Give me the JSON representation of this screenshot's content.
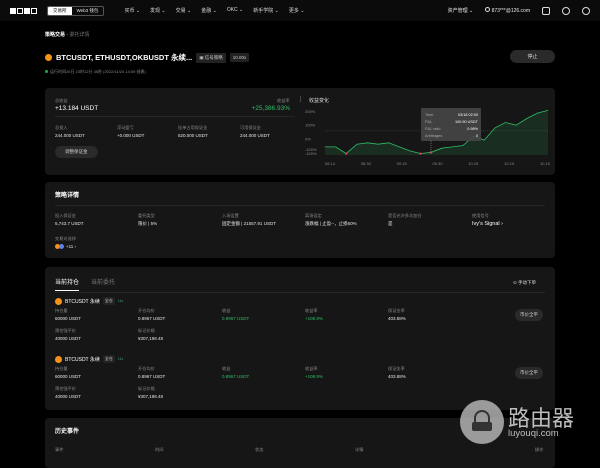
{
  "nav": {
    "exchange_tab": "交易所",
    "web3_tab": "Web3 钱包",
    "menu": [
      "买币 ⌄",
      "发现 ⌄",
      "交易 ⌄",
      "金融 ⌄",
      "OKC ⌄",
      "新手学院 ⌄",
      "更多 ⌄"
    ],
    "assets": "资产管理 ⌄",
    "user": "873***@126.com"
  },
  "breadcrumb": {
    "root": "策略交易",
    "sep": "›",
    "current": "委托详情"
  },
  "header": {
    "title": "BTCUSDT, ETHUSDT,OKBUSDT 永续...",
    "tag_signal": "▣ 信号策略",
    "leverage": "10.00x",
    "runtime": "运行时间26日 23时12分 35秒 (2022/11/24 14:59 创建)",
    "stop_label": "停止"
  },
  "summary": {
    "total_label": "总收益",
    "total_value": "+13.184 USDT",
    "rate_label": "收益率",
    "rate_value": "+25,386.93%",
    "stats": [
      {
        "label": "总投入",
        "value": "244.000 USDT"
      },
      {
        "label": "浮动盈亏",
        "value": "+0.000 USDT"
      },
      {
        "label": "挂单占用保证金",
        "value": "520.000 USDT"
      },
      {
        "label": "可用保证金",
        "value": "244.000 USDT"
      }
    ],
    "adjust_label": "调整保证金"
  },
  "chart_data": {
    "type": "line",
    "title": "收益变化",
    "y_ticks": [
      "200%",
      "100%",
      "0%",
      "-100%",
      "-100%"
    ],
    "x_ticks": [
      "08.14",
      "08.30",
      "09.15",
      "09.30",
      "10.15",
      "10.15",
      "10.15"
    ],
    "values": [
      -60,
      -60,
      -110,
      -40,
      -30,
      -40,
      -30,
      -60,
      -90,
      -110,
      -100,
      -70,
      -60,
      -50,
      20,
      -10,
      80,
      120,
      100,
      150,
      190,
      210
    ],
    "tooltip": {
      "time_label": "Time",
      "time": "03/18 02:00",
      "pnl_label": "P&L",
      "pnl": "100.90 USDT",
      "ratio_label": "P&L ratio",
      "ratio": "0.98%",
      "arb_label": "Arbitrages",
      "arb": "0"
    }
  },
  "details": {
    "title": "策略详情",
    "items": [
      {
        "label": "投入保证金",
        "value": "5,743.7 USDT"
      },
      {
        "label": "委托类型",
        "value": "限价 | 5%"
      },
      {
        "label": "入场设置",
        "value": "固定金额 | 21557.91 USDT"
      },
      {
        "label": "离场设定",
        "value": "涨跌幅 | 止盈--，止损60%"
      },
      {
        "label": "是否允许多次加仓",
        "value": "是"
      },
      {
        "label": "使用信号",
        "value": "Ivy's Signal ›"
      }
    ],
    "pairs_label": "交易对选择",
    "pairs_value": "+11 ›"
  },
  "positions": {
    "tabs": [
      "当前持仓",
      "当前委托"
    ],
    "manual_label": "手动下单",
    "rows": [
      {
        "name": "BTCUSDT 永续",
        "mode": "全仓",
        "lev": "11x",
        "fields": [
          {
            "label": "持仓量",
            "value": "60000 USDT"
          },
          {
            "label": "开仓均价",
            "value": "0.8967 USDT"
          },
          {
            "label": "收益",
            "value": "0.8967 USDT"
          },
          {
            "label": "收益率",
            "value": "+108.9%"
          },
          {
            "label": "保证金率",
            "value": "403.88%"
          }
        ],
        "fields2": [
          {
            "label": "预估强平价",
            "value": "40000 USDT"
          },
          {
            "label": "标记价格",
            "value": "¥307,198.48"
          }
        ],
        "close_label": "市价全平"
      },
      {
        "name": "BTCUSDT 永续",
        "mode": "全仓",
        "lev": "11x",
        "fields": [
          {
            "label": "持仓量",
            "value": "60000 USDT"
          },
          {
            "label": "开仓均价",
            "value": "0.8967 USDT"
          },
          {
            "label": "收益",
            "value": "0.8967 USDT"
          },
          {
            "label": "收益率",
            "value": "+108.9%"
          },
          {
            "label": "保证金率",
            "value": "403.88%"
          }
        ],
        "fields2": [
          {
            "label": "预估强平价",
            "value": "40000 USDT"
          },
          {
            "label": "标记价格",
            "value": "¥307,198.48"
          }
        ],
        "close_label": "市价全平"
      }
    ]
  },
  "history": {
    "title": "历史事件",
    "columns": [
      "事件",
      "时间",
      "状态",
      "详情",
      "操作"
    ]
  },
  "watermark": {
    "cn": "路由器",
    "en": "luyouqi.com"
  }
}
